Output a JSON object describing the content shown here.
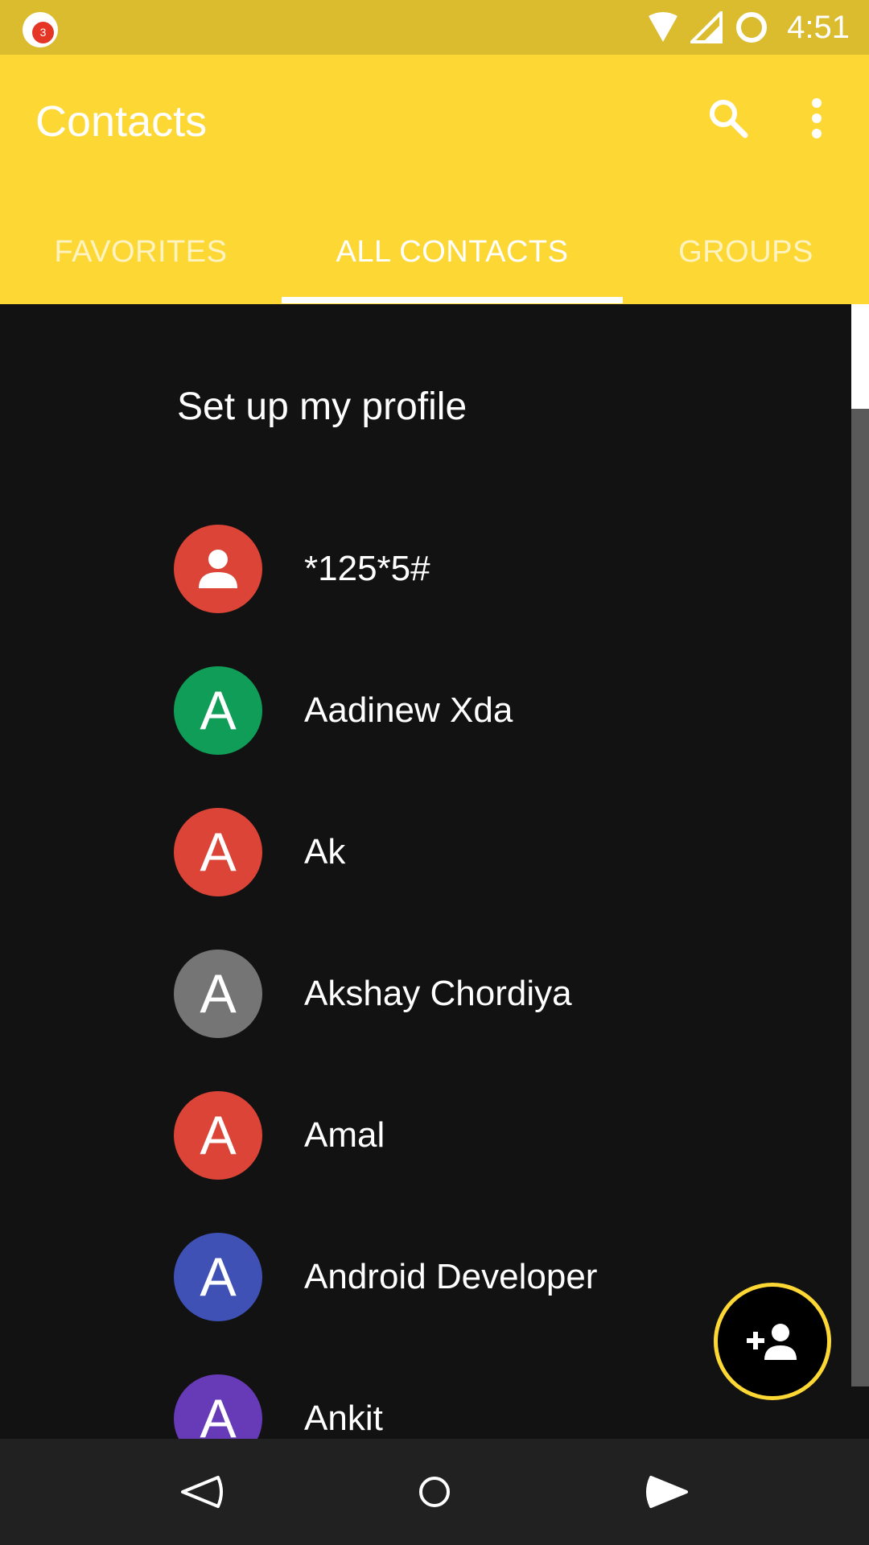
{
  "status_bar": {
    "notification_count": "3",
    "time": "4:51",
    "icons": [
      "notification-icon",
      "wifi-icon",
      "signal-icon",
      "data-saver-icon"
    ]
  },
  "app_bar": {
    "title": "Contacts",
    "actions": [
      "search-icon",
      "more-vert-icon"
    ]
  },
  "tabs": [
    {
      "label": "FAVORITES",
      "active": false
    },
    {
      "label": "ALL CONTACTS",
      "active": true
    },
    {
      "label": "GROUPS",
      "active": false
    }
  ],
  "profile_prompt": "Set up my profile",
  "contacts": [
    {
      "letter": "",
      "icon": "person-icon",
      "name": "*125*5#",
      "color": "#db4437"
    },
    {
      "letter": "A",
      "name": "Aadinew Xda",
      "color": "#0f9d58"
    },
    {
      "letter": "A",
      "name": "Ak",
      "color": "#db4437"
    },
    {
      "letter": "A",
      "name": "Akshay Chordiya",
      "color": "#757575"
    },
    {
      "letter": "A",
      "name": "Amal",
      "color": "#db4437"
    },
    {
      "letter": "A",
      "name": "Android Developer",
      "color": "#3f51b5"
    },
    {
      "letter": "A",
      "name": "Ankit",
      "color": "#673ab7"
    }
  ],
  "fab": {
    "icon": "add-person-icon"
  },
  "nav_bar": [
    "back-icon",
    "home-icon",
    "recents-icon"
  ],
  "colors": {
    "status_bar": "#dbbc2f",
    "app_bar": "#fdd835",
    "background": "#121212",
    "nav_bar": "#212121"
  }
}
